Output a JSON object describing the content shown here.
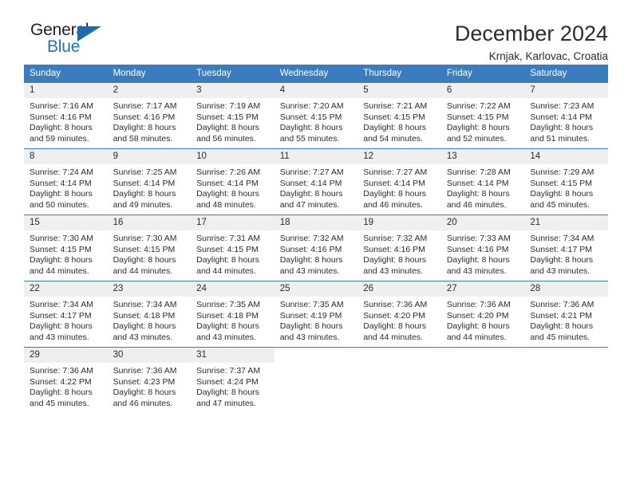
{
  "brand": {
    "name_part1": "General",
    "name_part2": "Blue",
    "mark": "triangle-logo-icon",
    "accent_color": "#1b75bb"
  },
  "header": {
    "title": "December 2024",
    "subtitle": "Krnjak, Karlovac, Croatia"
  },
  "theme": {
    "header_blue": "#3a7cbe",
    "daynum_gray": "#efefef",
    "text": "#2b2b2b"
  },
  "calendar": {
    "weekday_headers": [
      "Sunday",
      "Monday",
      "Tuesday",
      "Wednesday",
      "Thursday",
      "Friday",
      "Saturday"
    ],
    "weeks": [
      [
        {
          "day": "1",
          "sunrise": "Sunrise: 7:16 AM",
          "sunset": "Sunset: 4:16 PM",
          "daylight": "Daylight: 8 hours and 59 minutes."
        },
        {
          "day": "2",
          "sunrise": "Sunrise: 7:17 AM",
          "sunset": "Sunset: 4:16 PM",
          "daylight": "Daylight: 8 hours and 58 minutes."
        },
        {
          "day": "3",
          "sunrise": "Sunrise: 7:19 AM",
          "sunset": "Sunset: 4:15 PM",
          "daylight": "Daylight: 8 hours and 56 minutes."
        },
        {
          "day": "4",
          "sunrise": "Sunrise: 7:20 AM",
          "sunset": "Sunset: 4:15 PM",
          "daylight": "Daylight: 8 hours and 55 minutes."
        },
        {
          "day": "5",
          "sunrise": "Sunrise: 7:21 AM",
          "sunset": "Sunset: 4:15 PM",
          "daylight": "Daylight: 8 hours and 54 minutes."
        },
        {
          "day": "6",
          "sunrise": "Sunrise: 7:22 AM",
          "sunset": "Sunset: 4:15 PM",
          "daylight": "Daylight: 8 hours and 52 minutes."
        },
        {
          "day": "7",
          "sunrise": "Sunrise: 7:23 AM",
          "sunset": "Sunset: 4:14 PM",
          "daylight": "Daylight: 8 hours and 51 minutes."
        }
      ],
      [
        {
          "day": "8",
          "sunrise": "Sunrise: 7:24 AM",
          "sunset": "Sunset: 4:14 PM",
          "daylight": "Daylight: 8 hours and 50 minutes."
        },
        {
          "day": "9",
          "sunrise": "Sunrise: 7:25 AM",
          "sunset": "Sunset: 4:14 PM",
          "daylight": "Daylight: 8 hours and 49 minutes."
        },
        {
          "day": "10",
          "sunrise": "Sunrise: 7:26 AM",
          "sunset": "Sunset: 4:14 PM",
          "daylight": "Daylight: 8 hours and 48 minutes."
        },
        {
          "day": "11",
          "sunrise": "Sunrise: 7:27 AM",
          "sunset": "Sunset: 4:14 PM",
          "daylight": "Daylight: 8 hours and 47 minutes."
        },
        {
          "day": "12",
          "sunrise": "Sunrise: 7:27 AM",
          "sunset": "Sunset: 4:14 PM",
          "daylight": "Daylight: 8 hours and 46 minutes."
        },
        {
          "day": "13",
          "sunrise": "Sunrise: 7:28 AM",
          "sunset": "Sunset: 4:14 PM",
          "daylight": "Daylight: 8 hours and 46 minutes."
        },
        {
          "day": "14",
          "sunrise": "Sunrise: 7:29 AM",
          "sunset": "Sunset: 4:15 PM",
          "daylight": "Daylight: 8 hours and 45 minutes."
        }
      ],
      [
        {
          "day": "15",
          "sunrise": "Sunrise: 7:30 AM",
          "sunset": "Sunset: 4:15 PM",
          "daylight": "Daylight: 8 hours and 44 minutes."
        },
        {
          "day": "16",
          "sunrise": "Sunrise: 7:30 AM",
          "sunset": "Sunset: 4:15 PM",
          "daylight": "Daylight: 8 hours and 44 minutes."
        },
        {
          "day": "17",
          "sunrise": "Sunrise: 7:31 AM",
          "sunset": "Sunset: 4:15 PM",
          "daylight": "Daylight: 8 hours and 44 minutes."
        },
        {
          "day": "18",
          "sunrise": "Sunrise: 7:32 AM",
          "sunset": "Sunset: 4:16 PM",
          "daylight": "Daylight: 8 hours and 43 minutes."
        },
        {
          "day": "19",
          "sunrise": "Sunrise: 7:32 AM",
          "sunset": "Sunset: 4:16 PM",
          "daylight": "Daylight: 8 hours and 43 minutes."
        },
        {
          "day": "20",
          "sunrise": "Sunrise: 7:33 AM",
          "sunset": "Sunset: 4:16 PM",
          "daylight": "Daylight: 8 hours and 43 minutes."
        },
        {
          "day": "21",
          "sunrise": "Sunrise: 7:34 AM",
          "sunset": "Sunset: 4:17 PM",
          "daylight": "Daylight: 8 hours and 43 minutes."
        }
      ],
      [
        {
          "day": "22",
          "sunrise": "Sunrise: 7:34 AM",
          "sunset": "Sunset: 4:17 PM",
          "daylight": "Daylight: 8 hours and 43 minutes."
        },
        {
          "day": "23",
          "sunrise": "Sunrise: 7:34 AM",
          "sunset": "Sunset: 4:18 PM",
          "daylight": "Daylight: 8 hours and 43 minutes."
        },
        {
          "day": "24",
          "sunrise": "Sunrise: 7:35 AM",
          "sunset": "Sunset: 4:18 PM",
          "daylight": "Daylight: 8 hours and 43 minutes."
        },
        {
          "day": "25",
          "sunrise": "Sunrise: 7:35 AM",
          "sunset": "Sunset: 4:19 PM",
          "daylight": "Daylight: 8 hours and 43 minutes."
        },
        {
          "day": "26",
          "sunrise": "Sunrise: 7:36 AM",
          "sunset": "Sunset: 4:20 PM",
          "daylight": "Daylight: 8 hours and 44 minutes."
        },
        {
          "day": "27",
          "sunrise": "Sunrise: 7:36 AM",
          "sunset": "Sunset: 4:20 PM",
          "daylight": "Daylight: 8 hours and 44 minutes."
        },
        {
          "day": "28",
          "sunrise": "Sunrise: 7:36 AM",
          "sunset": "Sunset: 4:21 PM",
          "daylight": "Daylight: 8 hours and 45 minutes."
        }
      ],
      [
        {
          "day": "29",
          "sunrise": "Sunrise: 7:36 AM",
          "sunset": "Sunset: 4:22 PM",
          "daylight": "Daylight: 8 hours and 45 minutes."
        },
        {
          "day": "30",
          "sunrise": "Sunrise: 7:36 AM",
          "sunset": "Sunset: 4:23 PM",
          "daylight": "Daylight: 8 hours and 46 minutes."
        },
        {
          "day": "31",
          "sunrise": "Sunrise: 7:37 AM",
          "sunset": "Sunset: 4:24 PM",
          "daylight": "Daylight: 8 hours and 47 minutes."
        },
        {
          "day": "",
          "sunrise": "",
          "sunset": "",
          "daylight": ""
        },
        {
          "day": "",
          "sunrise": "",
          "sunset": "",
          "daylight": ""
        },
        {
          "day": "",
          "sunrise": "",
          "sunset": "",
          "daylight": ""
        },
        {
          "day": "",
          "sunrise": "",
          "sunset": "",
          "daylight": ""
        }
      ]
    ]
  }
}
